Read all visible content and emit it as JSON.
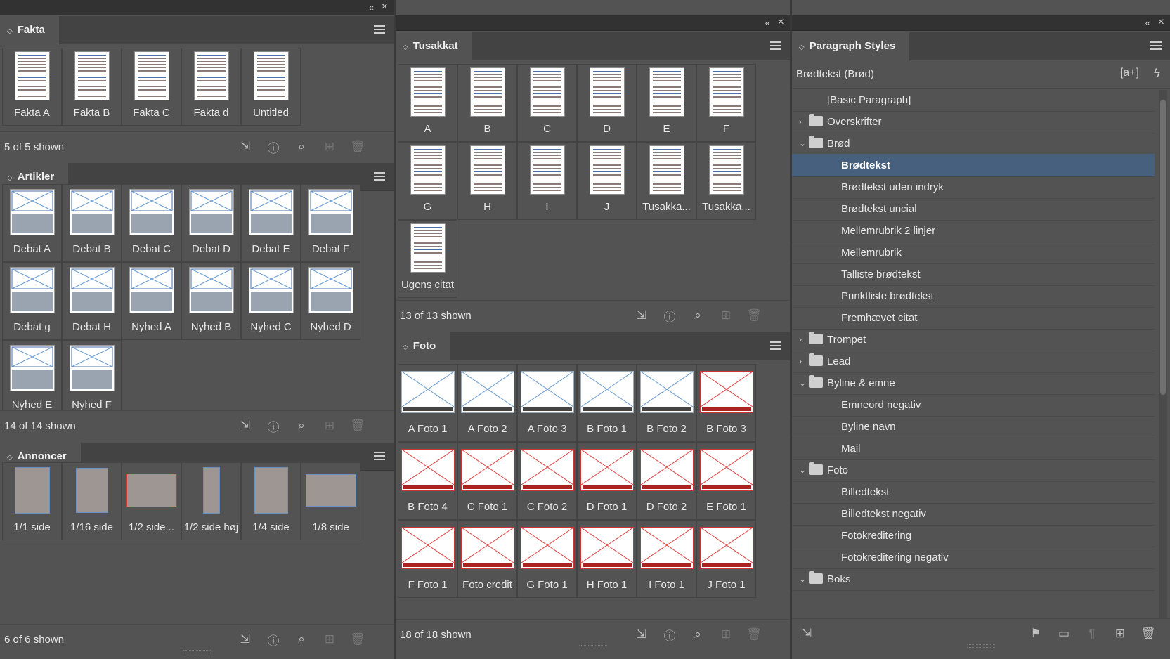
{
  "fakta": {
    "title": "Fakta",
    "items": [
      "Fakta A",
      "Fakta B",
      "Fakta C",
      "Fakta d",
      "Untitled"
    ],
    "count": "5 of 5 shown"
  },
  "artikler": {
    "title": "Artikler",
    "items": [
      "Debat A",
      "Debat B",
      "Debat C",
      "Debat D",
      "Debat E",
      "Debat F",
      "Debat g",
      "Debat H",
      "Nyhed A",
      "Nyhed B",
      "Nyhed C",
      "Nyhed D",
      "Nyhed E",
      "Nyhed F"
    ],
    "count": "14 of 14 shown"
  },
  "annoncer": {
    "title": "Annoncer",
    "items": [
      "1/1 side",
      "1/16 side",
      "1/2 side...",
      "1/2 side høj",
      "1/4 side",
      "1/8 side"
    ],
    "count": "6 of 6 shown"
  },
  "tusakkat": {
    "title": "Tusakkat",
    "items": [
      "A",
      "B",
      "C",
      "D",
      "E",
      "F",
      "G",
      "H",
      "I",
      "J",
      "Tusakka...",
      "Tusakka...",
      "Ugens citat"
    ],
    "count": "13 of 13 shown"
  },
  "foto": {
    "title": "Foto",
    "items": [
      "A Foto 1",
      "A Foto 2",
      "A Foto 3",
      "B Foto 1",
      "B Foto 2",
      "B Foto 3",
      "B Foto 4",
      "C Foto 1",
      "C Foto 2",
      "D Foto 1",
      "D Foto 2",
      "E Foto 1",
      "F Foto 1",
      "Foto credit",
      "G Foto 1",
      "H Foto 1",
      "I Foto 1",
      "J Foto 1"
    ],
    "count": "18 of 18 shown"
  },
  "styles": {
    "title": "Paragraph Styles",
    "current": "Brødtekst (Brød)",
    "rows": [
      {
        "label": "[Basic Paragraph]",
        "indent": 1,
        "folder": false
      },
      {
        "label": "Overskrifter",
        "indent": 0,
        "folder": true,
        "chev": "›"
      },
      {
        "label": "Brød",
        "indent": 0,
        "folder": true,
        "chev": "⌄"
      },
      {
        "label": "Brødtekst",
        "indent": 2,
        "folder": false,
        "selected": true
      },
      {
        "label": "Brødtekst uden indryk",
        "indent": 2,
        "folder": false
      },
      {
        "label": "Brødtekst uncial",
        "indent": 2,
        "folder": false
      },
      {
        "label": "Mellemrubrik 2 linjer",
        "indent": 2,
        "folder": false
      },
      {
        "label": "Mellemrubrik",
        "indent": 2,
        "folder": false
      },
      {
        "label": "Talliste brødtekst",
        "indent": 2,
        "folder": false
      },
      {
        "label": "Punktliste brødtekst",
        "indent": 2,
        "folder": false
      },
      {
        "label": "Fremhævet citat",
        "indent": 2,
        "folder": false
      },
      {
        "label": "Trompet",
        "indent": 0,
        "folder": true,
        "chev": "›"
      },
      {
        "label": "Lead",
        "indent": 0,
        "folder": true,
        "chev": "›"
      },
      {
        "label": "Byline & emne",
        "indent": 0,
        "folder": true,
        "chev": "⌄"
      },
      {
        "label": "Emneord  negativ",
        "indent": 2,
        "folder": false
      },
      {
        "label": "Byline navn",
        "indent": 2,
        "folder": false
      },
      {
        "label": "Mail",
        "indent": 2,
        "folder": false
      },
      {
        "label": "Foto",
        "indent": 0,
        "folder": true,
        "chev": "⌄"
      },
      {
        "label": "Billedtekst",
        "indent": 2,
        "folder": false
      },
      {
        "label": "Billedtekst negativ",
        "indent": 2,
        "folder": false
      },
      {
        "label": "Fotokreditering",
        "indent": 2,
        "folder": false
      },
      {
        "label": "Fotokreditering negativ",
        "indent": 2,
        "folder": false
      },
      {
        "label": "Boks",
        "indent": 0,
        "folder": true,
        "chev": "⌄"
      }
    ]
  }
}
